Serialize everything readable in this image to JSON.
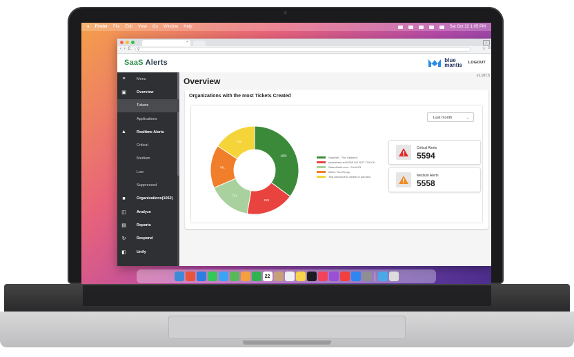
{
  "menubar": {
    "left": [
      "Finder",
      "File",
      "Edit",
      "View",
      "Go",
      "Window",
      "Help"
    ],
    "clock": "Sat Oct 22  1:05 PM"
  },
  "browser": {
    "tab_close": "×"
  },
  "header": {
    "logo_part1": "SaaS ",
    "logo_part2": "Alerts",
    "partner_line1": "blue",
    "partner_line2": "mantis",
    "logout": "LOGOUT"
  },
  "sidebar": {
    "items": [
      {
        "label": "Menu",
        "icon": "menu-icon",
        "kind": "sub"
      },
      {
        "label": "Overview",
        "icon": "overview-icon",
        "kind": "section"
      },
      {
        "label": "Tickets",
        "kind": "sub",
        "active": true
      },
      {
        "label": "Applications",
        "kind": "sub"
      },
      {
        "label": "Realtime Alerts",
        "icon": "alert-icon",
        "kind": "section"
      },
      {
        "label": "Critical",
        "kind": "sub"
      },
      {
        "label": "Medium",
        "kind": "sub"
      },
      {
        "label": "Low",
        "kind": "sub"
      },
      {
        "label": "Suppressed",
        "kind": "sub"
      },
      {
        "label": "Organizations(1062)",
        "icon": "briefcase-icon",
        "kind": "section"
      },
      {
        "label": "Analyze",
        "icon": "analyze-icon",
        "kind": "section"
      },
      {
        "label": "Reports",
        "icon": "reports-icon",
        "kind": "section"
      },
      {
        "label": "Respond",
        "icon": "respond-icon",
        "kind": "section"
      },
      {
        "label": "Unify",
        "icon": "unify-icon",
        "kind": "section"
      }
    ]
  },
  "main": {
    "version": "v1.107.5",
    "title": "Overview",
    "card_title": "Organizations with the most Tickets Created",
    "period_select": "Last month"
  },
  "stats": {
    "critical_label": "Critical Alerts",
    "critical_value": "5594",
    "medium_label": "Medium Alerts",
    "medium_value": "5558"
  },
  "chart_data": {
    "type": "pie",
    "donut": true,
    "categories": [
      "SaasNet - The Updated",
      "saasalerts.net M365 DO NOT TOUCH",
      "Saas Alerts.com - Pool123",
      "Mikes Test Group",
      "Test Microsoft to delete or add test"
    ],
    "values": [
      1650,
      826,
      741,
      741,
      740
    ],
    "colors": [
      "#3b8a3a",
      "#e8433f",
      "#a8d19e",
      "#f07e2a",
      "#f5d43a"
    ],
    "legend_position": "right"
  },
  "dock": {
    "icons": [
      {
        "name": "finder-icon",
        "color": "#3b8bd9"
      },
      {
        "name": "launchpad-icon",
        "color": "#e8553d"
      },
      {
        "name": "safari-icon",
        "color": "#2c7ee0"
      },
      {
        "name": "messages-icon",
        "color": "#34c759"
      },
      {
        "name": "mail-icon",
        "color": "#3da3f5"
      },
      {
        "name": "maps-icon",
        "color": "#59b85a"
      },
      {
        "name": "photos-icon",
        "color": "#f2a13c"
      },
      {
        "name": "facetime-icon",
        "color": "#2fb350"
      },
      {
        "name": "calendar-icon",
        "color": "#ffffff"
      },
      {
        "name": "contacts-icon",
        "color": "#c7a07a"
      },
      {
        "name": "reminders-icon",
        "color": "#f0f0f0"
      },
      {
        "name": "notes-icon",
        "color": "#f7d34a"
      },
      {
        "name": "tv-icon",
        "color": "#1c1c1e"
      },
      {
        "name": "music-icon",
        "color": "#f3435a"
      },
      {
        "name": "podcasts-icon",
        "color": "#9b4fd6"
      },
      {
        "name": "news-icon",
        "color": "#f1403d"
      },
      {
        "name": "app-store-icon",
        "color": "#2f86f0"
      },
      {
        "name": "system-preferences-icon",
        "color": "#8e8e93"
      },
      {
        "name": "downloads-icon",
        "color": "#4aa8e8"
      },
      {
        "name": "trash-icon",
        "color": "#dcdcdc"
      }
    ],
    "calendar_day": "22"
  }
}
